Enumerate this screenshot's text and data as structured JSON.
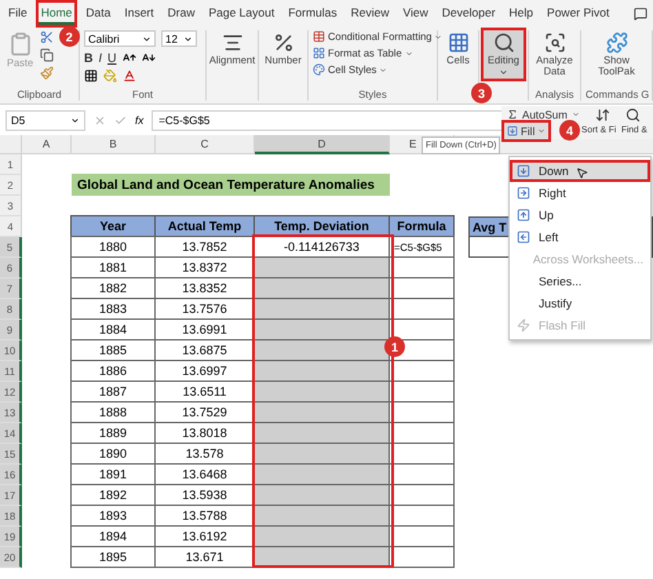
{
  "tabs": [
    {
      "label": "File",
      "selected": false
    },
    {
      "label": "Home",
      "selected": true,
      "callout": "2"
    },
    {
      "label": "Data",
      "selected": false
    },
    {
      "label": "Insert",
      "selected": false
    },
    {
      "label": "Draw",
      "selected": false
    },
    {
      "label": "Page Layout",
      "selected": false
    },
    {
      "label": "Formulas",
      "selected": false
    },
    {
      "label": "Review",
      "selected": false
    },
    {
      "label": "View",
      "selected": false
    },
    {
      "label": "Developer",
      "selected": false
    },
    {
      "label": "Help",
      "selected": false
    },
    {
      "label": "Power Pivot",
      "selected": false
    }
  ],
  "ribbon": {
    "clipboard": {
      "paste": "Paste",
      "label": "Clipboard"
    },
    "font": {
      "name": "Calibri",
      "size": "12",
      "bold": "B",
      "italic": "I",
      "underline": "U",
      "label": "Font"
    },
    "alignment": "Alignment",
    "number": "Number",
    "styles": {
      "items": [
        "Conditional Formatting",
        "Format as Table",
        "Cell Styles"
      ],
      "label": "Styles"
    },
    "cells": "Cells",
    "editing": {
      "button": "Editing",
      "callout": "3"
    },
    "analysis": {
      "button": "Analyze Data",
      "label": "Analysis"
    },
    "commands": {
      "button": "Show ToolPak",
      "label": "Commands G"
    }
  },
  "formula_bar": {
    "name_box": "D5",
    "fx_label": "fx",
    "formula": "=C5-$G$5"
  },
  "editing_panel": {
    "autosum": "AutoSum",
    "fill": "Fill",
    "fill_callout": "4",
    "sort": "Sort & Fi",
    "find": "Find &"
  },
  "tooltip": "Fill Down (Ctrl+D)",
  "fill_menu": [
    {
      "label": "Down",
      "kind": "down",
      "selected": true,
      "disabled": false
    },
    {
      "label": "Right",
      "kind": "right",
      "selected": false,
      "disabled": false
    },
    {
      "label": "Up",
      "kind": "up",
      "selected": false,
      "disabled": false
    },
    {
      "label": "Left",
      "kind": "left",
      "selected": false,
      "disabled": false
    },
    {
      "label": "Across Worksheets...",
      "kind": "plain",
      "selected": false,
      "disabled": true
    },
    {
      "label": "Series...",
      "kind": "plain",
      "selected": false,
      "disabled": false
    },
    {
      "label": "Justify",
      "kind": "plain",
      "selected": false,
      "disabled": false
    },
    {
      "label": "Flash Fill",
      "kind": "flash",
      "selected": false,
      "disabled": true
    }
  ],
  "sheet": {
    "columns": [
      {
        "label": "A",
        "selected": false
      },
      {
        "label": "B",
        "selected": false
      },
      {
        "label": "C",
        "selected": false
      },
      {
        "label": "D",
        "selected": true
      },
      {
        "label": "E",
        "selected": false
      }
    ],
    "row_numbers": [
      {
        "label": "1",
        "selected": false
      },
      {
        "label": "2",
        "selected": false
      },
      {
        "label": "3",
        "selected": false
      },
      {
        "label": "4",
        "selected": false
      },
      {
        "label": "5",
        "selected": true
      },
      {
        "label": "6",
        "selected": true
      },
      {
        "label": "7",
        "selected": true
      },
      {
        "label": "8",
        "selected": true
      },
      {
        "label": "9",
        "selected": true
      },
      {
        "label": "10",
        "selected": true
      },
      {
        "label": "11",
        "selected": true
      },
      {
        "label": "12",
        "selected": true
      },
      {
        "label": "13",
        "selected": true
      },
      {
        "label": "14",
        "selected": true
      },
      {
        "label": "15",
        "selected": true
      },
      {
        "label": "16",
        "selected": true
      },
      {
        "label": "17",
        "selected": true
      },
      {
        "label": "18",
        "selected": true
      },
      {
        "label": "19",
        "selected": true
      },
      {
        "label": "20",
        "selected": true
      }
    ],
    "title": "Global Land and Ocean Temperature Anomalies",
    "table": {
      "columns": [
        "Year",
        "Actual Temp",
        "Temp. Deviation",
        "Formula"
      ],
      "rows": [
        {
          "year": "1880",
          "temp": "13.7852",
          "deviation": "-0.114126733",
          "formula": "=C5-$G$5",
          "active": true
        },
        {
          "year": "1881",
          "temp": "13.8372",
          "active": false
        },
        {
          "year": "1882",
          "temp": "13.8352",
          "active": false
        },
        {
          "year": "1883",
          "temp": "13.7576",
          "active": false
        },
        {
          "year": "1884",
          "temp": "13.6991",
          "active": false
        },
        {
          "year": "1885",
          "temp": "13.6875",
          "active": false
        },
        {
          "year": "1886",
          "temp": "13.6997",
          "active": false
        },
        {
          "year": "1887",
          "temp": "13.6511",
          "active": false
        },
        {
          "year": "1888",
          "temp": "13.7529",
          "active": false
        },
        {
          "year": "1889",
          "temp": "13.8018",
          "active": false
        },
        {
          "year": "1890",
          "temp": "13.578",
          "active": false
        },
        {
          "year": "1891",
          "temp": "13.6468",
          "active": false
        },
        {
          "year": "1892",
          "temp": "13.5938",
          "active": false
        },
        {
          "year": "1893",
          "temp": "13.5788",
          "active": false
        },
        {
          "year": "1894",
          "temp": "13.6192",
          "active": false
        },
        {
          "year": "1895",
          "temp": "13.671",
          "active": false
        }
      ],
      "selection_callout": "1"
    },
    "side_header": "Avg T"
  }
}
